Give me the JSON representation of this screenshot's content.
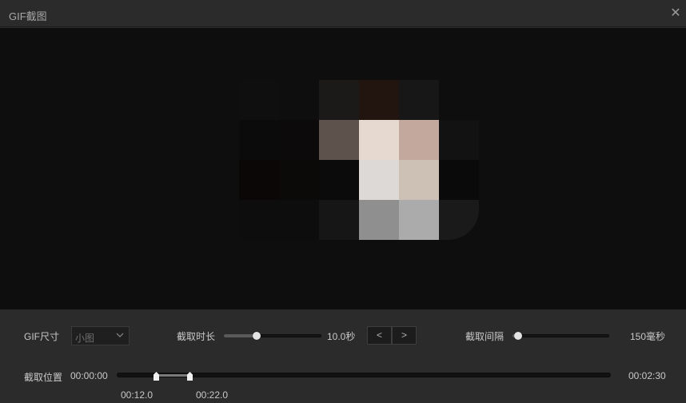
{
  "window": {
    "title": "GIF截图"
  },
  "preview": {
    "mosaic": [
      "#0f0f0f",
      "#0e0e0e",
      "#1c1a19",
      "#22140f",
      "#171717",
      "#0e0e0e",
      "#0b0b0b",
      "#0c0a0a",
      "#5e524d",
      "#e6d9d0",
      "#c3a99d",
      "#121212",
      "#0b0707",
      "#0c0909",
      "#0c0b0b",
      "#dcd9d6",
      "#cdc0b5",
      "#0a0a0a",
      "#0d0d0d",
      "#0d0d0d",
      "#161616",
      "#8f8f8f",
      "#ababab",
      "#1a1a1a"
    ]
  },
  "controls": {
    "size": {
      "label": "GIF尺寸",
      "value": "小图"
    },
    "duration": {
      "label": "截取时长",
      "value_text": "10.0秒",
      "value": 10.0,
      "min": 0,
      "max": 30
    },
    "interval": {
      "label": "截取间隔",
      "value_text": "150毫秒",
      "value": 150,
      "min": 100,
      "max": 1000
    },
    "position": {
      "label": "截取位置",
      "start_time": "00:00:00",
      "end_time": "00:02:30",
      "total_seconds": 150
    },
    "selection": {
      "start": 12.0,
      "end": 22.0,
      "start_text": "00:12.0",
      "end_text": "00:22.0"
    }
  },
  "colors": {
    "knob": "#e4e4e4",
    "track": "#151515",
    "selection": "#7a7a7a"
  }
}
